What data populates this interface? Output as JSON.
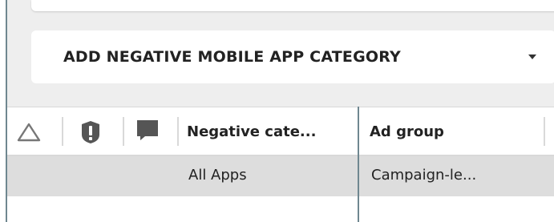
{
  "toolbar": {
    "add_button_label": "ADD NEGATIVE MOBILE APP CATEGORY",
    "dropdown_icon": "caret-down-icon"
  },
  "table": {
    "header": {
      "icons": [
        "warning-triangle-icon",
        "alert-exclamation-icon",
        "comment-icon"
      ],
      "columns": [
        "Negative cate...",
        "Ad group"
      ]
    },
    "rows": [
      {
        "negative_category": "All Apps",
        "ad_group": "Campaign-le..."
      }
    ]
  },
  "colors": {
    "panel_background": "#eeeeee",
    "row_selected": "#dddddd",
    "divider_accent": "#6f8790",
    "text": "#222222"
  }
}
